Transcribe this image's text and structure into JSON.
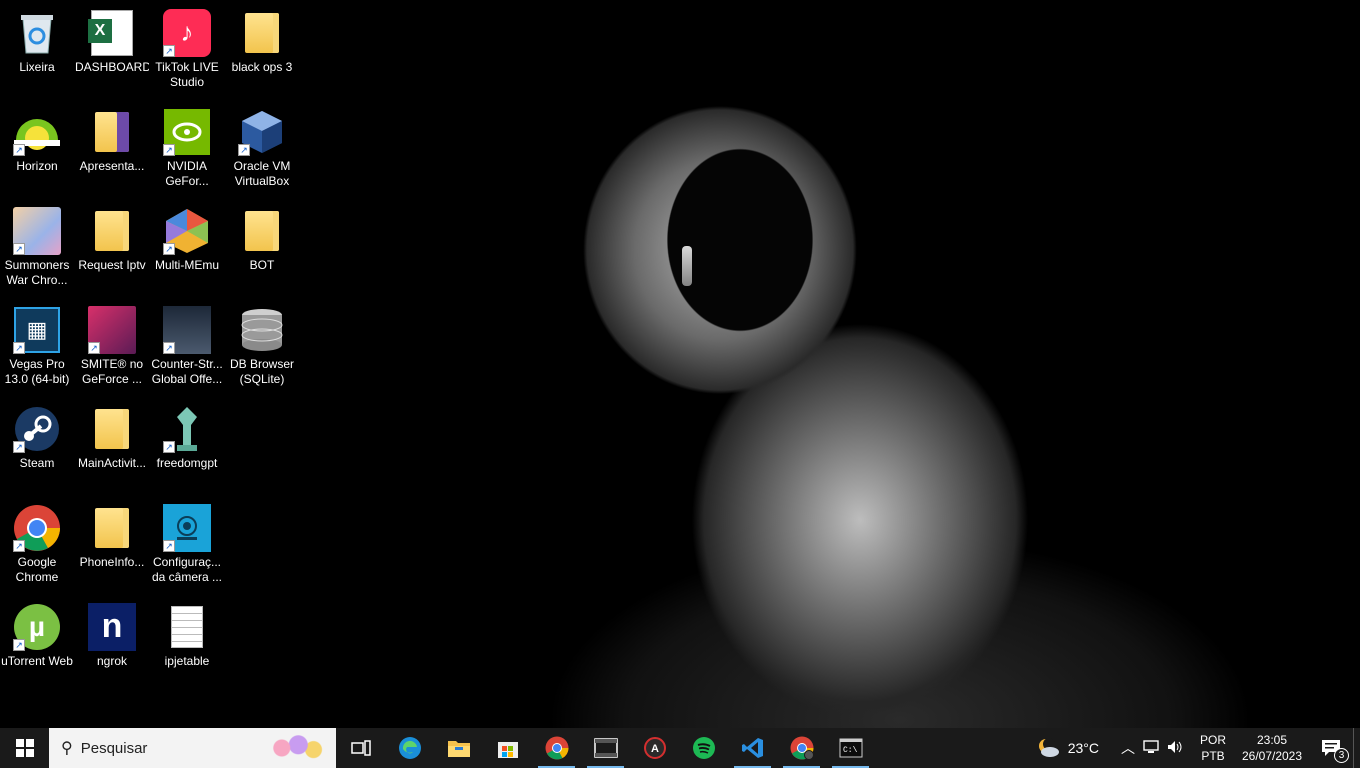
{
  "desktop": {
    "icons": [
      {
        "label": "Lixeira",
        "icon": "recycle-bin-icon"
      },
      {
        "label": "DASHBOARD",
        "icon": "excel-icon"
      },
      {
        "label": "TikTok LIVE\nStudio",
        "icon": "tiktok-live-icon"
      },
      {
        "label": "black ops 3",
        "icon": "folder-icon"
      },
      {
        "label": "Horizon",
        "icon": "horizon-icon"
      },
      {
        "label": "Apresenta...",
        "icon": "folder-icon"
      },
      {
        "label": "NVIDIA\nGeFor...",
        "icon": "nvidia-icon"
      },
      {
        "label": "Oracle VM\nVirtualBox",
        "icon": "virtualbox-icon"
      },
      {
        "label": "Summoners\nWar Chro...",
        "icon": "summoners-war-icon"
      },
      {
        "label": "Request Iptv",
        "icon": "folder-icon"
      },
      {
        "label": "Multi-MEmu",
        "icon": "memu-icon"
      },
      {
        "label": "BOT",
        "icon": "folder-icon"
      },
      {
        "label": "Vegas Pro\n13.0 (64-bit)",
        "icon": "vegas-pro-icon"
      },
      {
        "label": "SMITE® no\nGeForce ...",
        "icon": "smite-icon"
      },
      {
        "label": "Counter-Str...\nGlobal Offe...",
        "icon": "csgo-icon"
      },
      {
        "label": "DB Browser\n(SQLite)",
        "icon": "db-browser-icon"
      },
      {
        "label": "Steam",
        "icon": "steam-icon"
      },
      {
        "label": "MainActivit...",
        "icon": "folder-icon"
      },
      {
        "label": "freedomgpt",
        "icon": "freedomgpt-icon"
      },
      {
        "label": "Google\nChrome",
        "icon": "chrome-icon"
      },
      {
        "label": "PhoneInfo...",
        "icon": "folder-icon"
      },
      {
        "label": "Configuraç...\nda câmera ...",
        "icon": "camera-settings-icon"
      },
      {
        "label": "uTorrent Web",
        "icon": "utorrent-icon"
      },
      {
        "label": "ngrok",
        "icon": "ngrok-icon"
      },
      {
        "label": "ipjetable",
        "icon": "text-file-icon"
      }
    ]
  },
  "taskbar": {
    "search_placeholder": "Pesquisar",
    "apps": [
      "task-view-icon",
      "edge-icon",
      "file-explorer-icon",
      "store-icon",
      "chrome-icon",
      "clipchamp-icon",
      "aorus-icon",
      "spotify-icon",
      "vscode-icon",
      "chrome-profile-icon",
      "terminal-icon"
    ],
    "weather_temp": "23°C",
    "language_top": "POR",
    "language_bottom": "PTB",
    "time": "23:05",
    "date": "26/07/2023",
    "notification_count": "3"
  },
  "colors": {
    "taskbar_bg": "#1a1a1a",
    "accent": "#76b9ed"
  }
}
